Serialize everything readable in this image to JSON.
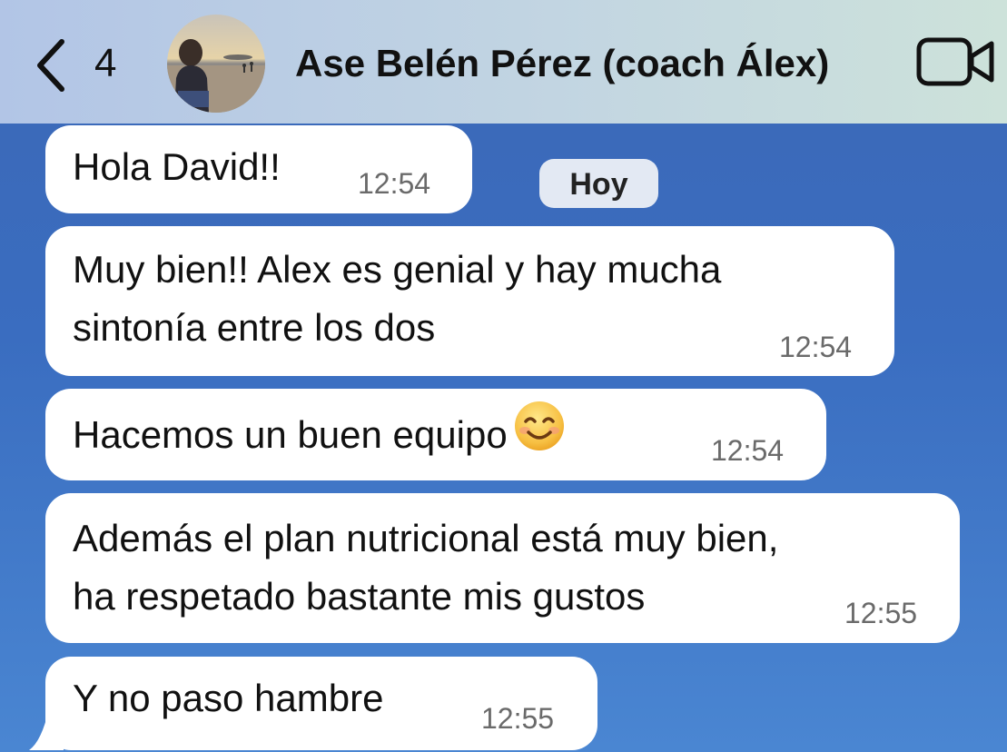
{
  "header": {
    "back_label": "4",
    "contact_name": "Ase Belén Pérez (coach Álex)",
    "avatar_icon": "contact-photo-avatar",
    "video_icon": "video-call-icon",
    "back_icon": "chevron-left-icon"
  },
  "chat": {
    "date_badge": "Hoy",
    "messages": [
      {
        "lines": [
          "Hola David!!"
        ],
        "time": "12:54"
      },
      {
        "lines": [
          "Muy bien!! Alex es genial y hay mucha",
          "sintonía entre los dos"
        ],
        "time": "12:54"
      },
      {
        "lines": [
          "Hacemos un buen equipo"
        ],
        "time": "12:54",
        "emoji": "smiling-face-emoji"
      },
      {
        "lines": [
          "Además el plan nutricional está muy bien,",
          "ha respetado bastante mis gustos"
        ],
        "time": "12:55"
      },
      {
        "lines": [
          "Y no paso hambre"
        ],
        "time": "12:55"
      }
    ]
  },
  "colors": {
    "bubble_bg": "#ffffff",
    "chat_bg": "#3c68b6",
    "header_bg": "#c2d5e2",
    "time_text": "#6a6a6a"
  }
}
